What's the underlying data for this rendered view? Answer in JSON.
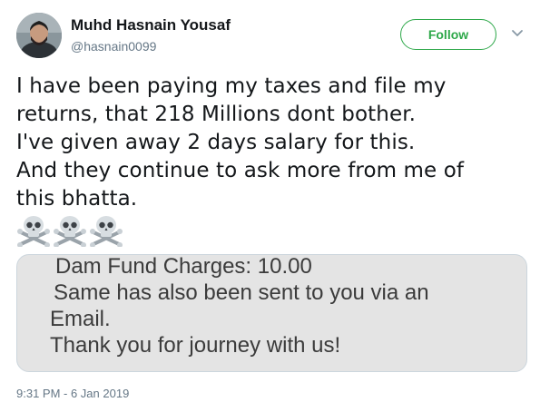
{
  "author": {
    "display_name": "Muhd Hasnain Yousaf",
    "handle": "@hasnain0099"
  },
  "actions": {
    "follow_label": "Follow",
    "more_icon": "chevron-down-icon"
  },
  "tweet": {
    "lines": [
      "I have been paying my taxes and file my",
      "returns, that 218 Millions dont bother.",
      "I've given away 2 days salary for this.",
      "And they continue to ask more from me of",
      "this bhatta."
    ],
    "emoji": [
      "skull-and-crossbones",
      "skull-and-crossbones",
      "skull-and-crossbones"
    ]
  },
  "media": {
    "lines": [
      "Dam Fund Charges: 10.00",
      "Same has also been sent to you via an",
      "Email.",
      "Thank you for journey with us!"
    ]
  },
  "timestamp": "9:31 PM - 6 Jan 2019",
  "colors": {
    "follow_green": "#2ea84a",
    "secondary_text": "#657786",
    "border": "#ccd6dd"
  }
}
